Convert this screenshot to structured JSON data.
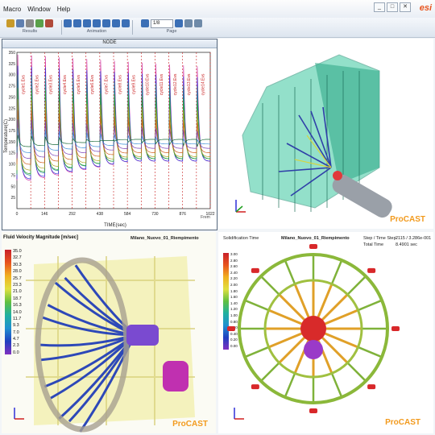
{
  "menu": [
    "Macro",
    "Window",
    "Help"
  ],
  "window_buttons": [
    "_",
    "□",
    "✕"
  ],
  "brand": "esi",
  "toolbar": {
    "groups": [
      "Results",
      "Animation",
      "Page"
    ],
    "page_value": "1/8"
  },
  "panel1": {
    "title": "NODE",
    "ylabel": "Temperature(C)",
    "xlabel": "TIME(sec)",
    "x_ticks": [
      "0",
      "146",
      "292",
      "438",
      "584",
      "730",
      "876",
      "1022"
    ],
    "y_ticks": [
      "350",
      "325",
      "300",
      "275",
      "250",
      "225",
      "200",
      "175",
      "150",
      "125",
      "100",
      "75",
      "50",
      "25"
    ],
    "cycle_labels": [
      "cycle1.Evs",
      "cycle2.Evs",
      "cycle3.Evs",
      "cycle4.Evs",
      "cycle5.Evs",
      "cycle6.Evs",
      "cycle7.Evs",
      "cycle8.Evs",
      "cycle9.Evs",
      "cycle10.Evs",
      "cycle11.Evs",
      "cycle12.Evs",
      "cycle13.Evs",
      "cycle14.Evs"
    ],
    "corner_label": "Frem"
  },
  "panel2": {
    "logo": "ProCAST"
  },
  "panel3": {
    "legend_title": "Fluid Velocity Magnitude [m/sec]",
    "case_title": "Milano_Nuovo_01_Riempimento",
    "legend_values": [
      "35.0",
      "32.7",
      "30.3",
      "28.0",
      "25.7",
      "23.3",
      "21.0",
      "18.7",
      "16.3",
      "14.0",
      "11.7",
      "9.3",
      "7.0",
      "4.7",
      "2.3",
      "0.0"
    ],
    "logo": "ProCAST"
  },
  "panel4": {
    "legend_title": "Solidification Time",
    "case_title": "Milano_Nuovo_01_Riempimento",
    "step_label": "Step / Time Step",
    "step_value": "2115 / 3.286e-001",
    "total_label": "Total Time",
    "total_value": "8.4901 sec",
    "legend_values": [
      "3.00",
      "2.80",
      "2.60",
      "2.40",
      "2.20",
      "2.00",
      "1.80",
      "1.60",
      "1.40",
      "1.20",
      "1.00",
      "0.80",
      "0.60",
      "0.40",
      "0.20",
      "0.00"
    ],
    "logo": "ProCAST"
  },
  "chart_data": {
    "type": "line",
    "title": "NODE",
    "xlabel": "TIME(sec)",
    "ylabel": "Temperature(C)",
    "xlim": [
      0,
      1022
    ],
    "ylim": [
      0,
      350
    ],
    "cycles": 14,
    "cycle_period_sec": 73,
    "series": [
      {
        "peak": 345,
        "base": 40,
        "color": "#d23aa8"
      },
      {
        "peak": 320,
        "base": 45,
        "color": "#2e2ed8"
      },
      {
        "peak": 300,
        "base": 55,
        "color": "#1c8a8a"
      },
      {
        "peak": 270,
        "base": 60,
        "color": "#2fa82f"
      },
      {
        "peak": 245,
        "base": 70,
        "color": "#b0a020"
      },
      {
        "peak": 220,
        "base": 85,
        "color": "#d35d1a"
      },
      {
        "peak": 200,
        "base": 100,
        "color": "#7a3fb8"
      },
      {
        "peak": 180,
        "base": 115,
        "color": "#3a8fd8"
      },
      {
        "peak": 165,
        "base": 130,
        "color": "#1a6b3a"
      }
    ],
    "legend_position": "none",
    "grid": false
  }
}
